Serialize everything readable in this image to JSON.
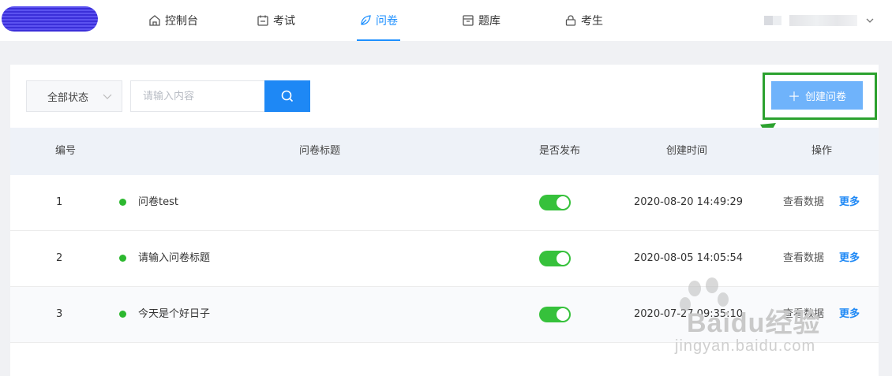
{
  "nav": {
    "items": [
      {
        "label": "控制台",
        "icon": "home-icon"
      },
      {
        "label": "考试",
        "icon": "calendar-icon"
      },
      {
        "label": "问卷",
        "icon": "leaf-icon",
        "active": true
      },
      {
        "label": "题库",
        "icon": "archive-icon"
      },
      {
        "label": "考生",
        "icon": "lock-icon"
      }
    ]
  },
  "toolbar": {
    "status_label": "全部状态",
    "search_placeholder": "请输入内容",
    "create_label": "创建问卷"
  },
  "table": {
    "headers": [
      "编号",
      "问卷标题",
      "是否发布",
      "创建时间",
      "操作"
    ],
    "rows": [
      {
        "id": "1",
        "title": "问卷test",
        "published": true,
        "created": "2020-08-20 14:49:29",
        "view": "查看数据",
        "more": "更多"
      },
      {
        "id": "2",
        "title": "请输入问卷标题",
        "published": true,
        "created": "2020-08-05 14:05:54",
        "view": "查看数据",
        "more": "更多"
      },
      {
        "id": "3",
        "title": "今天是个好日子",
        "published": true,
        "created": "2020-07-27 09:35:10",
        "view": "查看数据",
        "more": "更多"
      }
    ]
  },
  "watermark": {
    "text": "Baidu经验",
    "sub": "jingyan.baidu.com"
  },
  "colors": {
    "accent": "#1e88f5",
    "highlight": "#2ba12e",
    "published": "#36c13b"
  }
}
